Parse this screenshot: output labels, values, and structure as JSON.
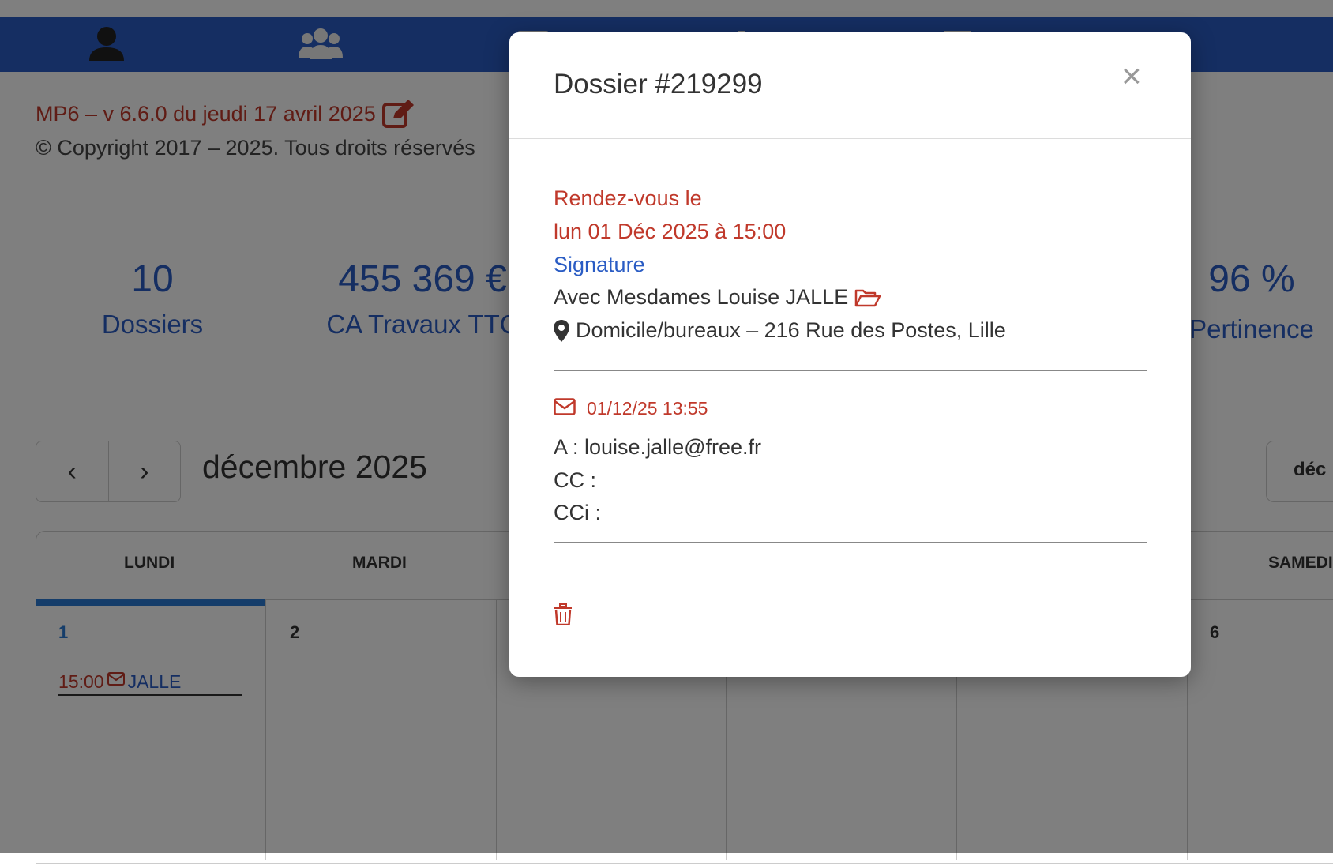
{
  "app": {
    "version_text": "MP6 – v 6.6.0 du jeudi 17 avril 2025",
    "copyright": "© Copyright 2017 – 2025. Tous droits réservés"
  },
  "nav": {
    "icons": [
      "user-icon",
      "users-icon",
      "list-icon",
      "chart-icon",
      "dashboard-icon"
    ],
    "background": "#2a5cc4"
  },
  "stats": [
    {
      "value": "10",
      "label": "Dossiers"
    },
    {
      "value": "455 369 €",
      "label": "CA Travaux TTC"
    },
    {
      "value": "96 %",
      "label": "Pertinence"
    }
  ],
  "calendar": {
    "prev_label": "‹",
    "next_label": "›",
    "month_label": "décembre 2025",
    "month_select": "déc",
    "day_headers": [
      "LUNDI",
      "MARDI",
      "SAMEDI"
    ],
    "day_numbers": [
      "1",
      "2",
      "6"
    ],
    "event": {
      "time": "15:00",
      "name": "JALLE"
    }
  },
  "modal": {
    "title": "Dossier #219299",
    "close_label": "×",
    "rdv_label": "Rendez-vous le",
    "rdv_datetime": "lun 01 Déc 2025 à 15:00",
    "type": "Signature",
    "with_text": "Avec Mesdames Louise JALLE",
    "location": "Domicile/bureaux – 216 Rue des Postes, Lille",
    "mail": {
      "date": "01/12/25 13:55",
      "to": "A : louise.jalle@free.fr",
      "cc": "CC :",
      "cci": "CCi :"
    }
  },
  "colors": {
    "accent_red": "#c0392b",
    "accent_blue": "#2a5cc4",
    "today_bar": "#2a7bd4"
  }
}
